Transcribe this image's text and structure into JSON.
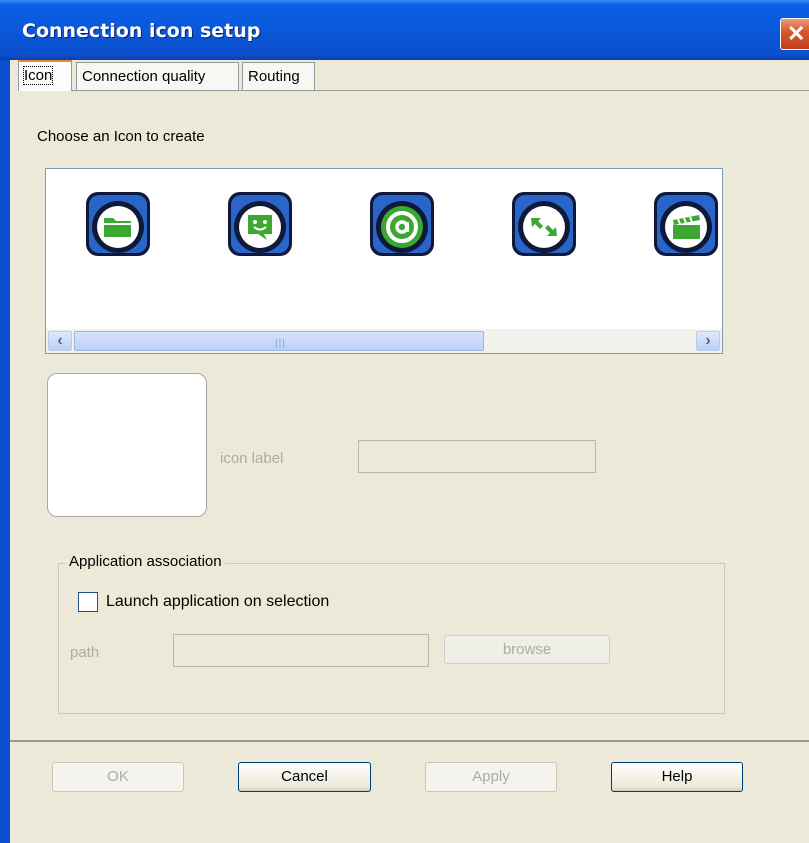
{
  "window": {
    "title": "Connection icon setup",
    "close_icon": "close-icon"
  },
  "tabs": [
    {
      "label": "Icon",
      "active": true
    },
    {
      "label": "Connection quality",
      "active": false
    },
    {
      "label": "Routing",
      "active": false
    }
  ],
  "icon_tab": {
    "choose_label": "Choose an Icon to create",
    "icons": [
      "folder-icon",
      "chat-icon",
      "at-sign-icon",
      "arrows-icon",
      "clapperboard-icon"
    ],
    "scrollbar_grip": "|||",
    "icon_label_text": "icon label",
    "icon_label_value": ""
  },
  "application_association": {
    "title": "Application association",
    "launch_label": "Launch application on selection",
    "launch_checked": false,
    "path_label": "path",
    "path_value": "",
    "browse_label": "browse"
  },
  "buttons": {
    "ok": "OK",
    "cancel": "Cancel",
    "apply": "Apply",
    "help": "Help"
  },
  "colors": {
    "titlebar": "#0a58db",
    "icon_dark": "#0f1a3a",
    "icon_blue": "#2a66c9",
    "icon_green": "#3ca832",
    "tab_highlight": "#e68b2c"
  }
}
